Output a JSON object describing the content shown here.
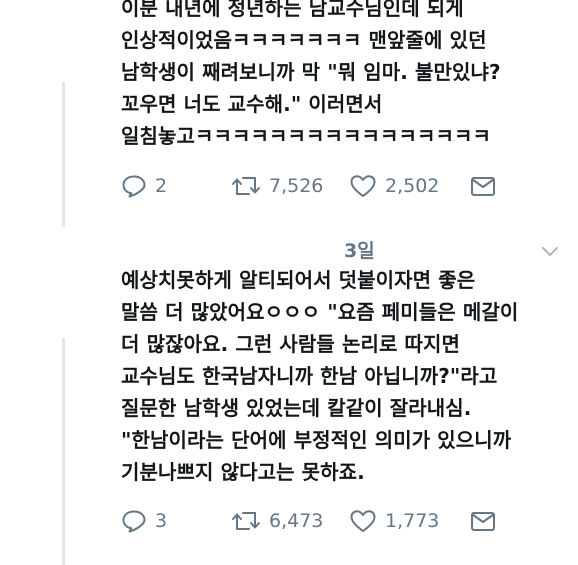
{
  "tweet1": {
    "text": "이분 내년에 정년하는 남교수님인데 되게\n인상적이었음ㅋㅋㅋㅋㅋㅋㅋ 맨앞줄에 있던\n남학생이 째려보니까 막 \"뭐 임마. 불만있냐?\n꼬우면 너도 교수해.\" 이러면서\n일침놓고ㅋㅋㅋㅋㅋㅋㅋㅋㅋㅋㅋㅋㅋㅋㅋㅋ",
    "replies": "2",
    "retweets": "7,526",
    "likes": "2,502"
  },
  "tweet2": {
    "date": "3일",
    "text": "예상치못하게 알티되어서 덧붙이자면 좋은\n말씀 더 많았어요ㅇㅇㅇ \"요즘 페미들은 메갈이\n더 많잖아요. 그런 사람들 논리로 따지면\n교수님도 한국남자니까 한남 아닙니까?\"라고\n질문한 남학생 있었는데 칼같이 잘라내심.\n\"한남이라는 단어에 부정적인 의미가 있으니까\n기분나쁘지 않다고는 못하죠.",
    "replies": "3",
    "retweets": "6,473",
    "likes": "1,773"
  },
  "icons": {
    "reply": "reply-icon",
    "retweet": "retweet-icon",
    "like": "heart-icon",
    "dm": "envelope-icon",
    "caret": "chevron-down-icon"
  },
  "colors": {
    "text": "#14171a",
    "meta": "#657786",
    "thread_line": "#e1e8ed"
  }
}
